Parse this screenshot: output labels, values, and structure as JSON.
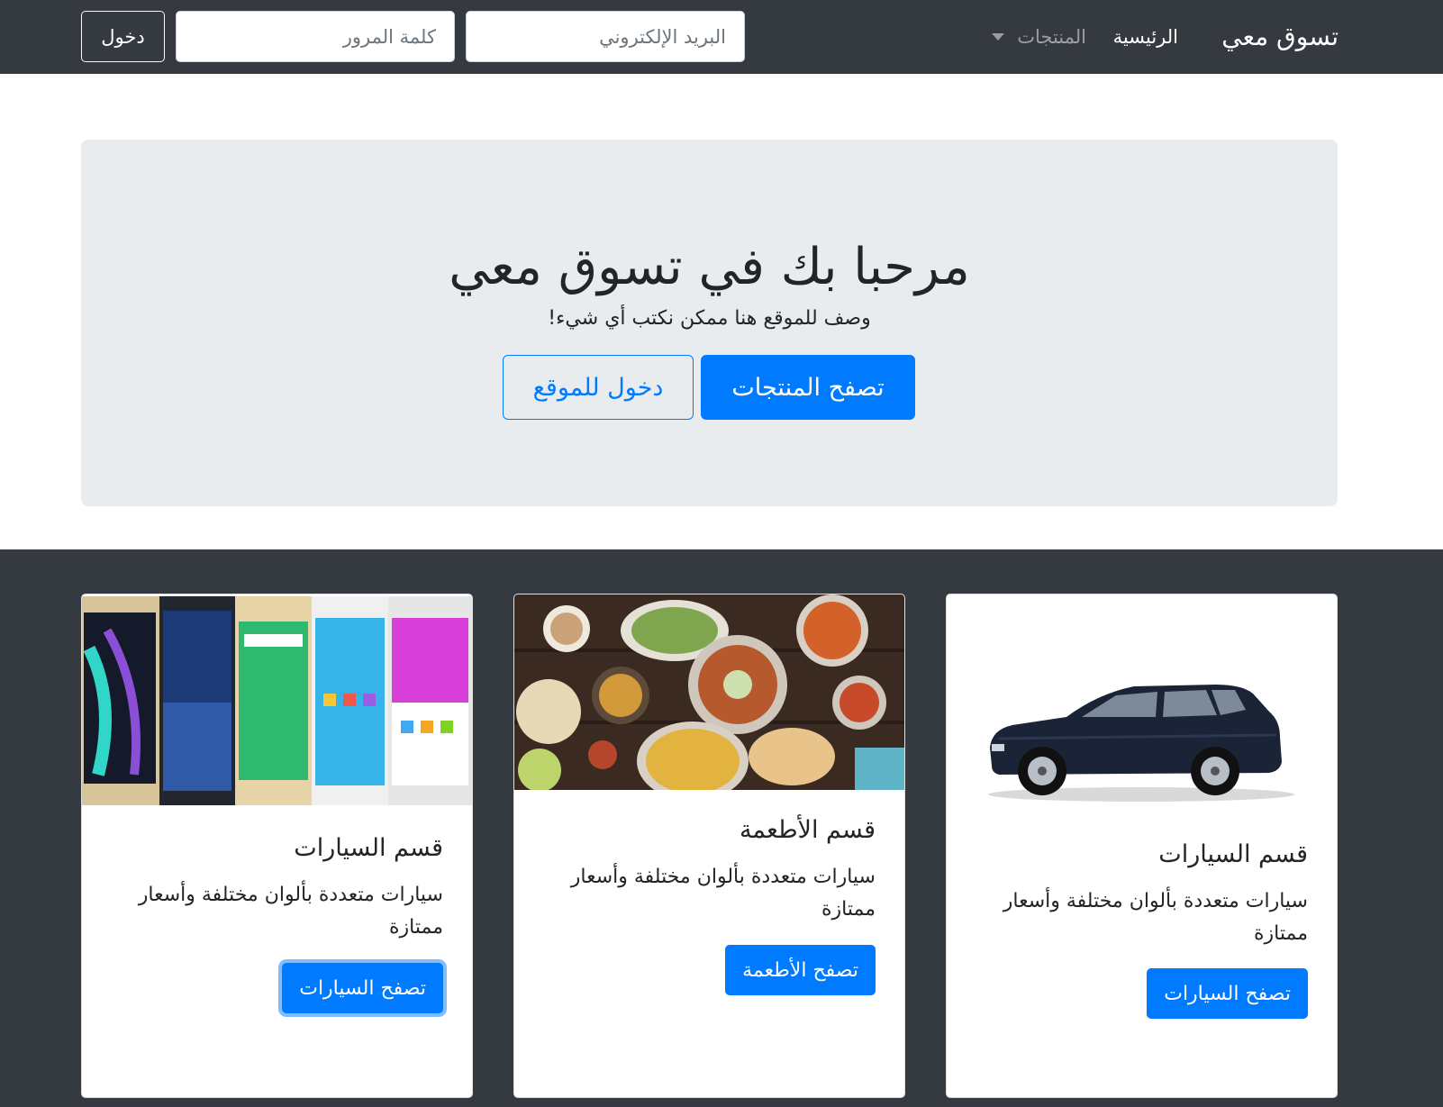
{
  "navbar": {
    "brand": "تسوق معي",
    "home_label": "الرئيسية",
    "products_label": "المنتجات",
    "email_placeholder": "البريد الإلكتروني",
    "password_placeholder": "كلمة المرور",
    "login_label": "دخول"
  },
  "hero": {
    "title": "مرحبا بك في تسوق معي",
    "lead": "وصف للموقع هنا ممكن نكتب أي شيء!",
    "browse_products_label": "تصفح المنتجات",
    "site_login_label": "دخول للموقع"
  },
  "colors": {
    "navbar_bg": "#343a40",
    "primary": "#007bff",
    "jumbotron_bg": "#e9ecef"
  },
  "cards": [
    {
      "image": "car-image",
      "title": "قسم السيارات",
      "text": "سيارات متعددة بألوان مختلفة وأسعار ممتازة",
      "button_label": "تصفح السيارات"
    },
    {
      "image": "food-image",
      "title": "قسم الأطعمة",
      "text": "سيارات متعددة بألوان مختلفة وأسعار ممتازة",
      "button_label": "تصفح الأطعمة"
    },
    {
      "image": "phones-image",
      "title": "قسم السيارات",
      "text": "سيارات متعددة بألوان مختلفة وأسعار ممتازة",
      "button_label": "تصفح السيارات"
    }
  ]
}
